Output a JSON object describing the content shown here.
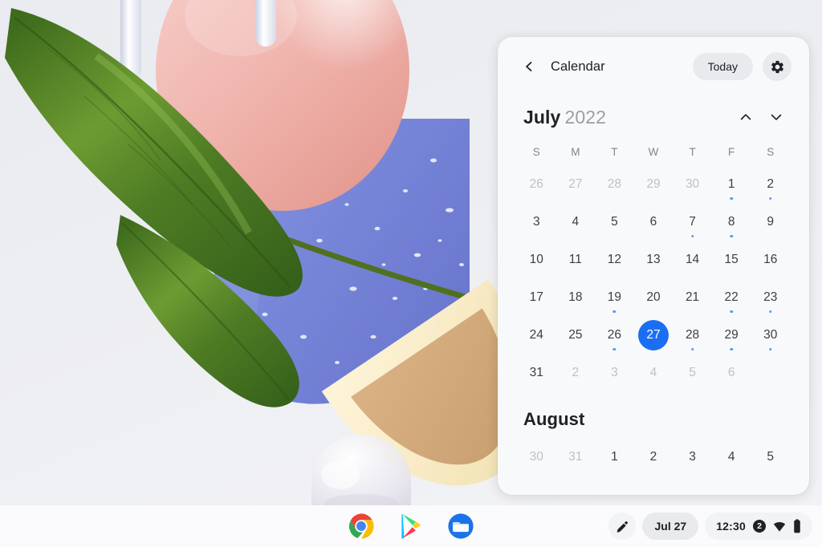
{
  "desktop": {
    "wallpaper_name": "abstract-3d-shapes-wallpaper",
    "colors": {
      "background": "#eceef2",
      "sphere_pink": "#f0b3b0",
      "leaf_green": "#4e7c24",
      "cylinder_blue": "#7d8fe0",
      "disc_cream": "#f3e6c4",
      "disc_tan": "#cfa878"
    }
  },
  "calendar": {
    "back_icon": "chevron-left-icon",
    "title": "Calendar",
    "today_label": "Today",
    "settings_icon": "gear-icon",
    "prev_icon": "chevron-up-icon",
    "next_icon": "chevron-down-icon",
    "accent_color": "#1b6ef3",
    "weekdays": [
      "S",
      "M",
      "T",
      "W",
      "T",
      "F",
      "S"
    ],
    "months": [
      {
        "name": "July",
        "year": "2022",
        "days": [
          {
            "n": "26",
            "adjacent": true,
            "dot": false,
            "selected": false
          },
          {
            "n": "27",
            "adjacent": true,
            "dot": false,
            "selected": false
          },
          {
            "n": "28",
            "adjacent": true,
            "dot": false,
            "selected": false
          },
          {
            "n": "29",
            "adjacent": true,
            "dot": false,
            "selected": false
          },
          {
            "n": "30",
            "adjacent": true,
            "dot": false,
            "selected": false
          },
          {
            "n": "1",
            "adjacent": false,
            "dot": true,
            "selected": false
          },
          {
            "n": "2",
            "adjacent": false,
            "dot": true,
            "selected": false
          },
          {
            "n": "3",
            "adjacent": false,
            "dot": false,
            "selected": false
          },
          {
            "n": "4",
            "adjacent": false,
            "dot": false,
            "selected": false
          },
          {
            "n": "5",
            "adjacent": false,
            "dot": false,
            "selected": false
          },
          {
            "n": "6",
            "adjacent": false,
            "dot": false,
            "selected": false
          },
          {
            "n": "7",
            "adjacent": false,
            "dot": true,
            "selected": false
          },
          {
            "n": "8",
            "adjacent": false,
            "dot": true,
            "selected": false
          },
          {
            "n": "9",
            "adjacent": false,
            "dot": false,
            "selected": false
          },
          {
            "n": "10",
            "adjacent": false,
            "dot": false,
            "selected": false
          },
          {
            "n": "11",
            "adjacent": false,
            "dot": false,
            "selected": false
          },
          {
            "n": "12",
            "adjacent": false,
            "dot": false,
            "selected": false
          },
          {
            "n": "13",
            "adjacent": false,
            "dot": false,
            "selected": false
          },
          {
            "n": "14",
            "adjacent": false,
            "dot": false,
            "selected": false
          },
          {
            "n": "15",
            "adjacent": false,
            "dot": false,
            "selected": false
          },
          {
            "n": "16",
            "adjacent": false,
            "dot": false,
            "selected": false
          },
          {
            "n": "17",
            "adjacent": false,
            "dot": false,
            "selected": false
          },
          {
            "n": "18",
            "adjacent": false,
            "dot": false,
            "selected": false
          },
          {
            "n": "19",
            "adjacent": false,
            "dot": true,
            "selected": false
          },
          {
            "n": "20",
            "adjacent": false,
            "dot": false,
            "selected": false
          },
          {
            "n": "21",
            "adjacent": false,
            "dot": false,
            "selected": false
          },
          {
            "n": "22",
            "adjacent": false,
            "dot": true,
            "selected": false
          },
          {
            "n": "23",
            "adjacent": false,
            "dot": true,
            "selected": false
          },
          {
            "n": "24",
            "adjacent": false,
            "dot": false,
            "selected": false
          },
          {
            "n": "25",
            "adjacent": false,
            "dot": false,
            "selected": false
          },
          {
            "n": "26",
            "adjacent": false,
            "dot": true,
            "selected": false
          },
          {
            "n": "27",
            "adjacent": false,
            "dot": false,
            "selected": true
          },
          {
            "n": "28",
            "adjacent": false,
            "dot": true,
            "selected": false
          },
          {
            "n": "29",
            "adjacent": false,
            "dot": true,
            "selected": false
          },
          {
            "n": "30",
            "adjacent": false,
            "dot": true,
            "selected": false
          },
          {
            "n": "31",
            "adjacent": false,
            "dot": false,
            "selected": false
          },
          {
            "n": "2",
            "adjacent": true,
            "dot": false,
            "selected": false
          },
          {
            "n": "3",
            "adjacent": true,
            "dot": false,
            "selected": false
          },
          {
            "n": "4",
            "adjacent": true,
            "dot": false,
            "selected": false
          },
          {
            "n": "5",
            "adjacent": true,
            "dot": false,
            "selected": false
          },
          {
            "n": "6",
            "adjacent": true,
            "dot": false,
            "selected": false
          }
        ]
      },
      {
        "name": "August",
        "year": "",
        "days": [
          {
            "n": "30",
            "adjacent": true,
            "dot": false,
            "selected": false
          },
          {
            "n": "31",
            "adjacent": true,
            "dot": false,
            "selected": false
          },
          {
            "n": "1",
            "adjacent": false,
            "dot": false,
            "selected": false
          },
          {
            "n": "2",
            "adjacent": false,
            "dot": false,
            "selected": false
          },
          {
            "n": "3",
            "adjacent": false,
            "dot": false,
            "selected": false
          },
          {
            "n": "4",
            "adjacent": false,
            "dot": false,
            "selected": false
          },
          {
            "n": "5",
            "adjacent": false,
            "dot": false,
            "selected": false
          }
        ]
      }
    ]
  },
  "shelf": {
    "apps": [
      {
        "name": "chrome-app-icon",
        "label": "Chrome"
      },
      {
        "name": "play-store-app-icon",
        "label": "Play Store"
      },
      {
        "name": "files-app-icon",
        "label": "Files"
      }
    ],
    "status": {
      "stylus_icon": "stylus-icon",
      "date": "Jul 27",
      "time": "12:30",
      "notification_count": "2",
      "network_icon": "wifi-icon",
      "battery_icon": "battery-icon"
    }
  }
}
